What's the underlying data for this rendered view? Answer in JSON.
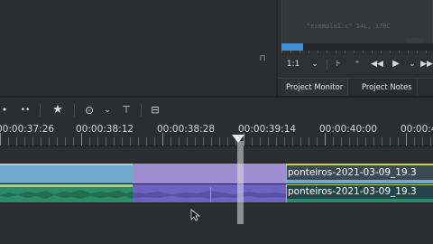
{
  "monitor": {
    "code_snippet": "\"exemplo1.c\" 14L, 170C",
    "progress_fraction": 0.14,
    "zoom_label": "1:1",
    "zoom_caret": "⌄",
    "icons": [
      "set-zone-in-icon",
      "set-zone-out-icon",
      "rewind-icon",
      "play-icon",
      "play-dropdown-icon",
      "forward-icon"
    ]
  },
  "tabs": {
    "project_monitor": "Project Monitor",
    "project_notes": "Project Notes"
  },
  "toolbar": {
    "icons": [
      "dots-icon",
      "dots2-icon",
      "favorite-star-icon",
      "record-icon",
      "dropdown-caret-icon",
      "fit-icon",
      "toolbox-icon"
    ]
  },
  "ruler": {
    "timecodes": [
      "00:00:37:26",
      "00:00:38:12",
      "00:00:38:28",
      "00:00:39:14",
      "00:00:40:00",
      "00:00:40:1"
    ]
  },
  "clips": {
    "video_label": "ponteiros-2021-03-09_19.3",
    "audio_label": "ponteiros-2021-03-09_19.3"
  },
  "colors": {
    "video_clip": "#6fa9cc",
    "selected_video_clip": "#9e8fd0",
    "audio_clip": "#2d8a6a",
    "selected_audio_clip": "#6d63bf",
    "progress": "#3d8fd1",
    "clip_edge_marker": "#c6d64a"
  }
}
